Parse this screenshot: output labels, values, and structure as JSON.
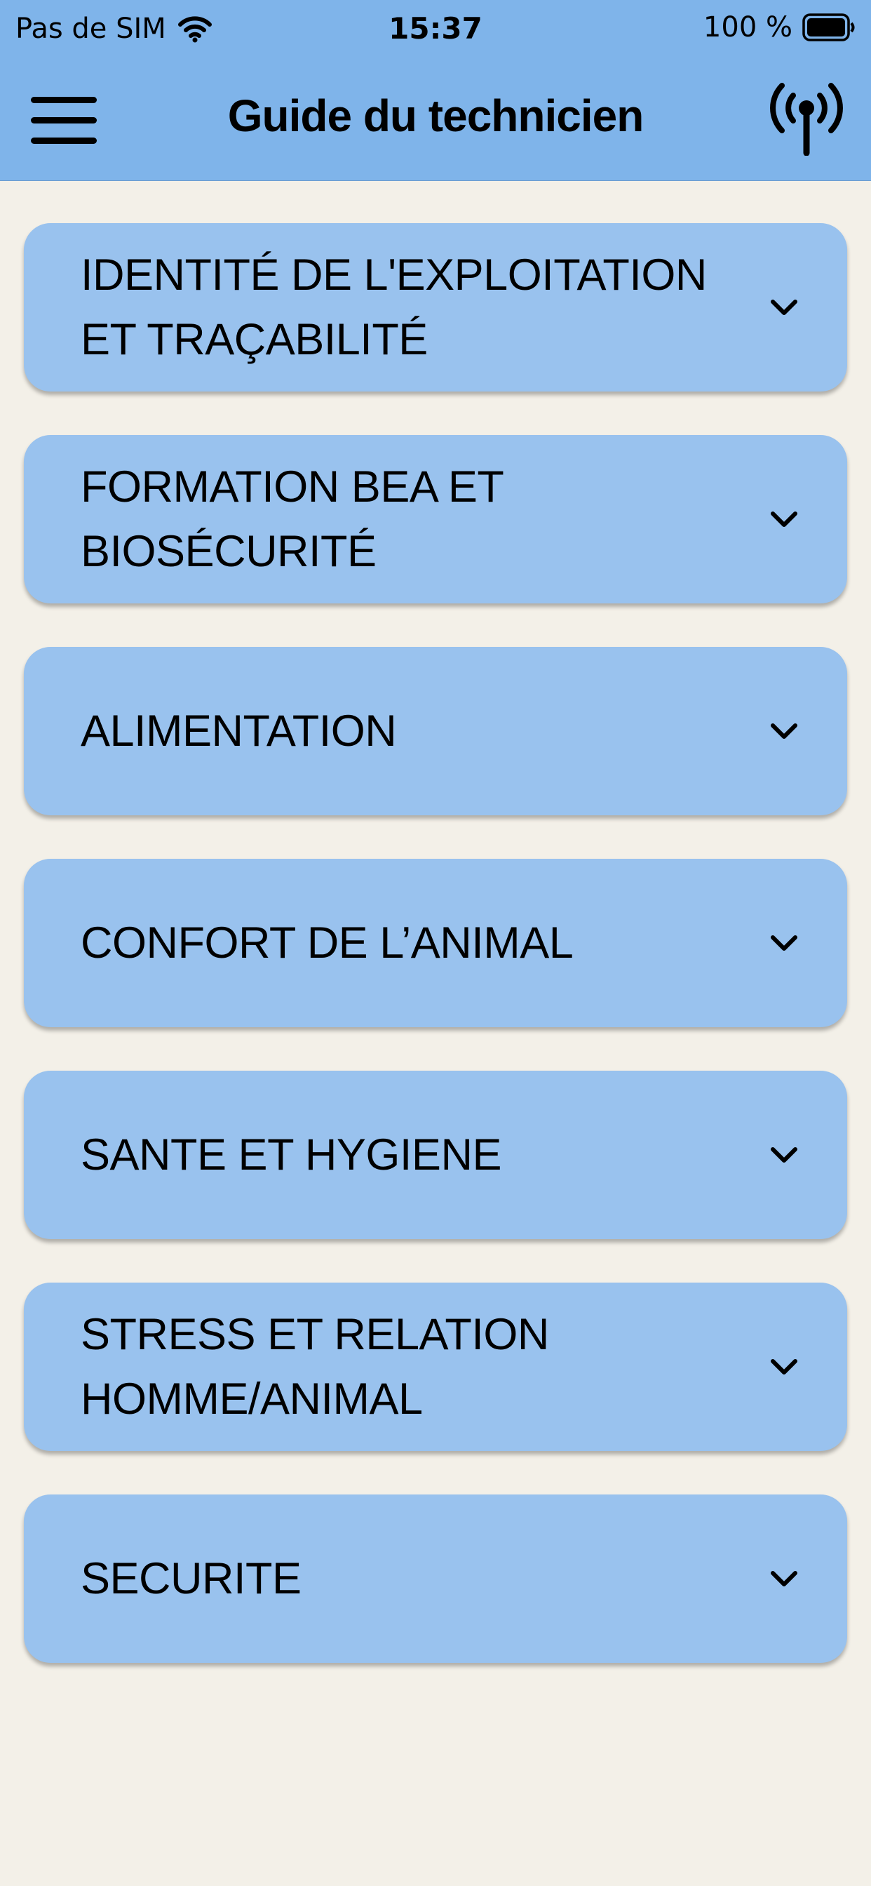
{
  "status_bar": {
    "carrier": "Pas de SIM",
    "time": "15:37",
    "battery": "100 %",
    "icons": [
      "wifi-icon",
      "battery-icon"
    ]
  },
  "header": {
    "title": "Guide du technicien",
    "left_icon": "hamburger-menu-icon",
    "right_icon": "antenna-icon"
  },
  "sections": [
    {
      "label": "IDENTITÉ DE L'EXPLOITATION ET TRAÇABILITÉ",
      "icon": "chevron-down-icon"
    },
    {
      "label": "FORMATION BEA ET BIOSÉCURITÉ",
      "icon": "chevron-down-icon"
    },
    {
      "label": "ALIMENTATION",
      "icon": "chevron-down-icon"
    },
    {
      "label": "CONFORT DE L’ANIMAL",
      "icon": "chevron-down-icon"
    },
    {
      "label": "SANTE ET HYGIENE",
      "icon": "chevron-down-icon"
    },
    {
      "label": "STRESS ET RELATION HOMME/ANIMAL",
      "icon": "chevron-down-icon"
    },
    {
      "label": "SECURITE",
      "icon": "chevron-down-icon"
    }
  ],
  "colors": {
    "header_background": "#7fb4ea",
    "card_background": "#99c2ee",
    "page_background": "#f3f0e8"
  }
}
